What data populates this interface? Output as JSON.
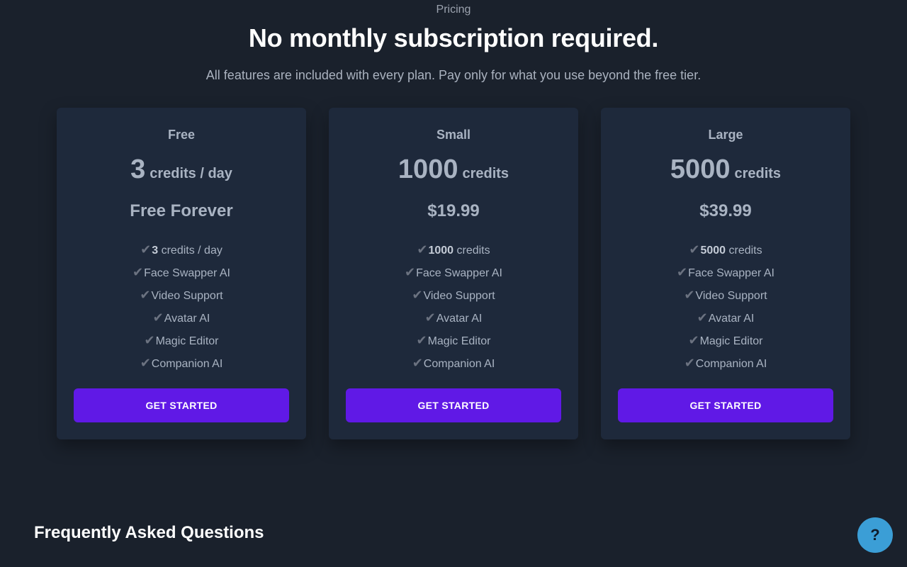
{
  "header": {
    "eyebrow": "Pricing",
    "title": "No monthly subscription required.",
    "subtitle": "All features are included with every plan. Pay only for what you use beyond the free tier."
  },
  "plans": [
    {
      "name": "Free",
      "credit_amount": "3",
      "credit_unit": "credits / day",
      "price": "Free Forever",
      "features": [
        {
          "bold": "3",
          "text": " credits / day"
        },
        {
          "bold": "",
          "text": "Face Swapper AI"
        },
        {
          "bold": "",
          "text": "Video Support"
        },
        {
          "bold": "",
          "text": "Avatar AI"
        },
        {
          "bold": "",
          "text": "Magic Editor"
        },
        {
          "bold": "",
          "text": "Companion AI"
        }
      ],
      "cta": "GET STARTED"
    },
    {
      "name": "Small",
      "credit_amount": "1000",
      "credit_unit": "credits",
      "price": "$19.99",
      "features": [
        {
          "bold": "1000",
          "text": " credits"
        },
        {
          "bold": "",
          "text": "Face Swapper AI"
        },
        {
          "bold": "",
          "text": "Video Support"
        },
        {
          "bold": "",
          "text": "Avatar AI"
        },
        {
          "bold": "",
          "text": "Magic Editor"
        },
        {
          "bold": "",
          "text": "Companion AI"
        }
      ],
      "cta": "GET STARTED"
    },
    {
      "name": "Large",
      "credit_amount": "5000",
      "credit_unit": "credits",
      "price": "$39.99",
      "features": [
        {
          "bold": "5000",
          "text": " credits"
        },
        {
          "bold": "",
          "text": "Face Swapper AI"
        },
        {
          "bold": "",
          "text": "Video Support"
        },
        {
          "bold": "",
          "text": "Avatar AI"
        },
        {
          "bold": "",
          "text": "Magic Editor"
        },
        {
          "bold": "",
          "text": "Companion AI"
        }
      ],
      "cta": "GET STARTED"
    }
  ],
  "check_glyph": "✔",
  "faq": {
    "title": "Frequently Asked Questions"
  },
  "help_button": {
    "label": "?",
    "icon": "help-icon"
  },
  "colors": {
    "background": "#1a212c",
    "card": "#1e293b",
    "accent": "#6019e6",
    "help": "#3b9ed6"
  }
}
